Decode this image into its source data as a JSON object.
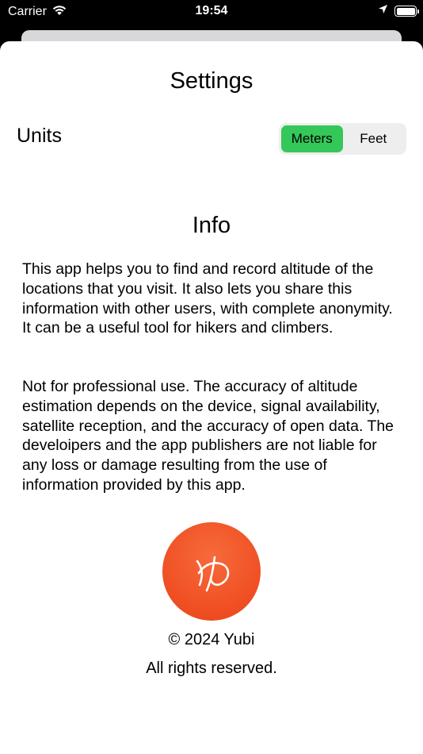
{
  "status_bar": {
    "carrier": "Carrier",
    "time": "19:54",
    "wifi_icon": "wifi-icon",
    "location_icon": "location-arrow-icon",
    "battery_icon": "battery-full-icon"
  },
  "settings": {
    "title": "Settings",
    "units_label": "Units",
    "units_options": [
      "Meters",
      "Feet"
    ],
    "units_selected": "Meters"
  },
  "info": {
    "title": "Info",
    "paragraph1": "This app helps you to find and record altitude of the locations that you visit. It also lets you share this information with other users, with complete anonymity. It can be a useful tool for hikers and climbers.",
    "paragraph2": "Not for professional use. The accuracy of altitude estimation depends on the device, signal availability, satellite reception, and the accuracy of open  data. The develoipers and the app publishers are not liable for any loss or damage resulting from the use of information provided by this app."
  },
  "footer": {
    "logo_icon": "yubi-logo-icon",
    "copyright": "© 2024 Yubi",
    "rights": "All rights reserved."
  },
  "colors": {
    "accent_green": "#34c759",
    "logo_orange": "#ef4e22",
    "sheet_background": "#ffffff",
    "status_background": "#000000"
  }
}
